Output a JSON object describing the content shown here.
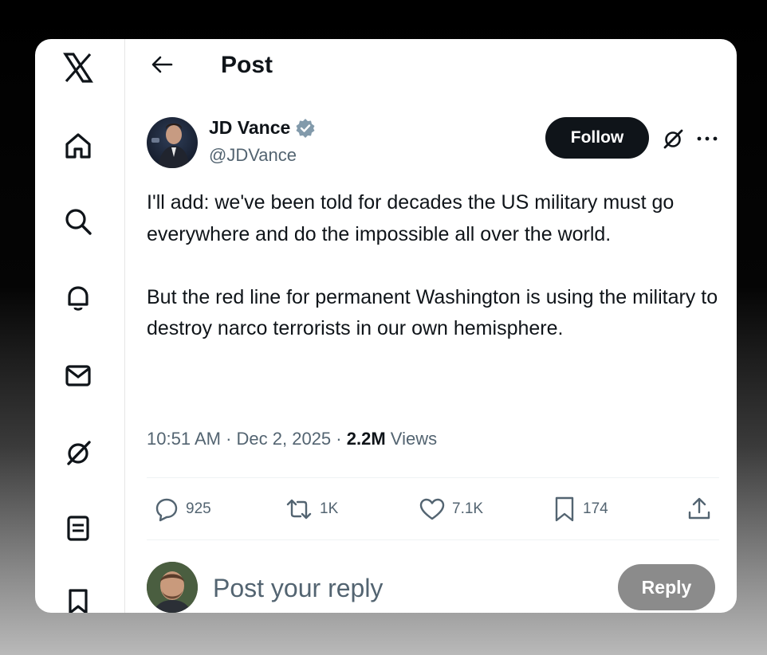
{
  "header": {
    "title": "Post"
  },
  "author": {
    "name": "JD Vance",
    "handle": "@JDVance",
    "verified_color": "#829aab"
  },
  "buttons": {
    "follow": "Follow",
    "reply": "Reply"
  },
  "post": {
    "paragraphs": [
      "I'll add: we've been told for decades the US military must go everywhere and do the impossible all over the world.",
      "But the red line for permanent Washington is using the military to destroy narco terrorists in our own hemisphere."
    ],
    "time": "10:51 AM",
    "date": "Dec 2, 2025",
    "views_count": "2.2M",
    "views_label": "Views"
  },
  "actions": {
    "replies": "925",
    "reposts": "1K",
    "likes": "7.1K",
    "bookmarks": "174"
  },
  "reply_box": {
    "placeholder": "Post your reply"
  },
  "sidebar": [
    "x-logo-icon",
    "home-icon",
    "search-icon",
    "notifications-icon",
    "messages-icon",
    "grok-icon",
    "lists-icon",
    "bookmarks-icon"
  ],
  "colors": {
    "text": "#0f1419",
    "muted": "#536471",
    "button_dark": "#0f1419",
    "reply_disabled": "#8b8b8b"
  }
}
